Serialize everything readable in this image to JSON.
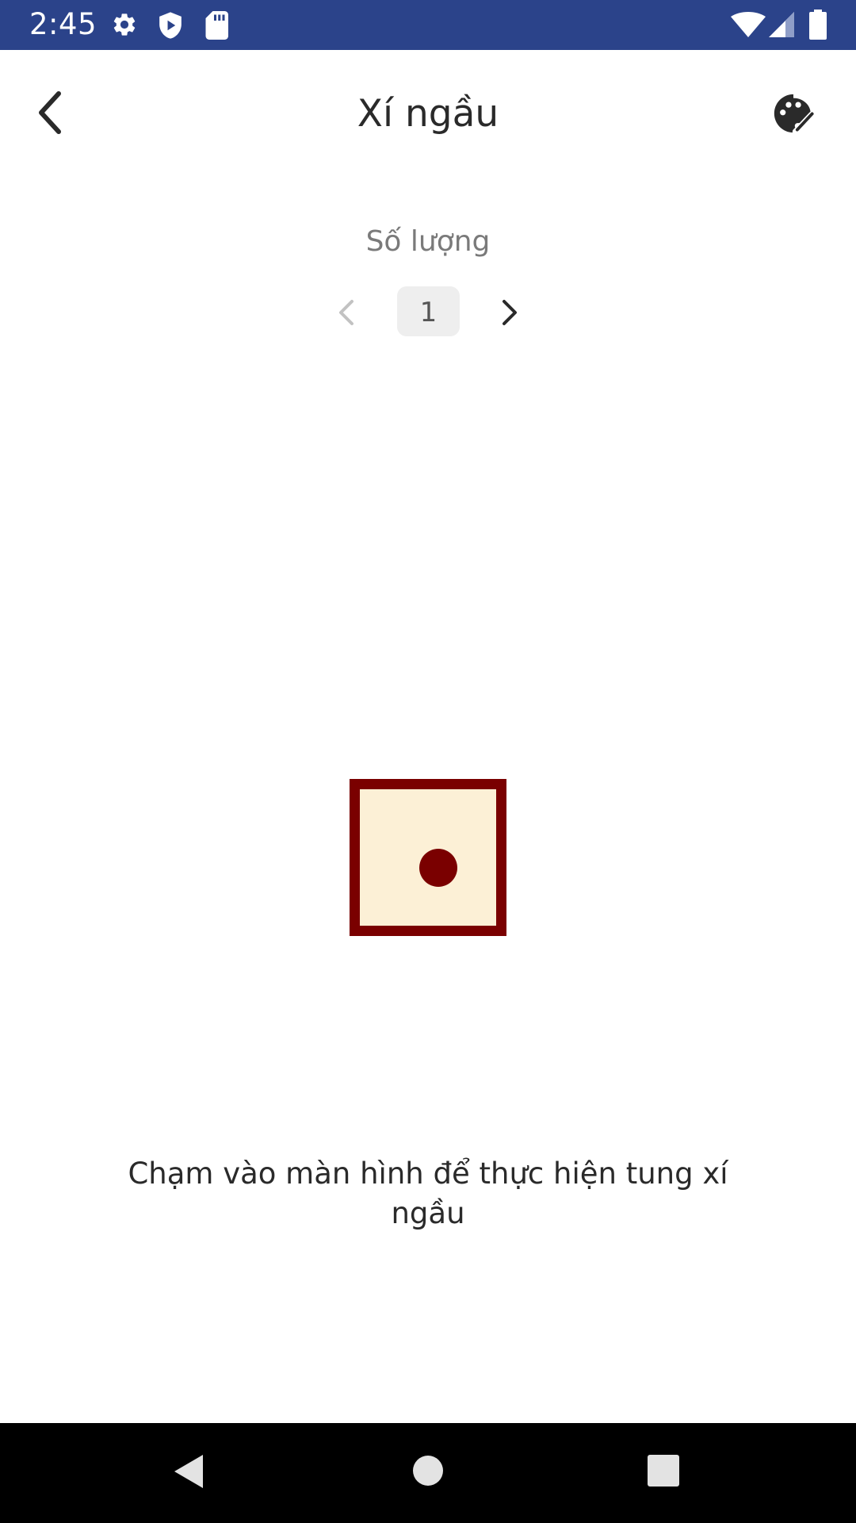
{
  "status_bar": {
    "time": "2:45",
    "left_icons": [
      "gear-icon",
      "shield-play-icon",
      "sd-card-icon"
    ],
    "right_icons": [
      "wifi-icon",
      "signal-icon",
      "battery-icon"
    ],
    "background": "#2b438a"
  },
  "header": {
    "title": "Xí ngầu",
    "back_icon": "chevron-left-icon",
    "theme_icon": "palette-icon"
  },
  "quantity": {
    "label": "Số lượng",
    "value": "1",
    "prev_icon": "chevron-left-icon",
    "next_icon": "chevron-right-icon"
  },
  "dice": [
    {
      "face": 1
    }
  ],
  "instruction": "Chạm vào màn hình để thực hiện tung xí ngầu",
  "colors": {
    "die_border": "#7a0000",
    "die_face": "#fcf0d6",
    "pip": "#7a0000"
  },
  "nav_bar": {
    "icons": [
      "nav-back-icon",
      "nav-home-icon",
      "nav-recents-icon"
    ]
  }
}
